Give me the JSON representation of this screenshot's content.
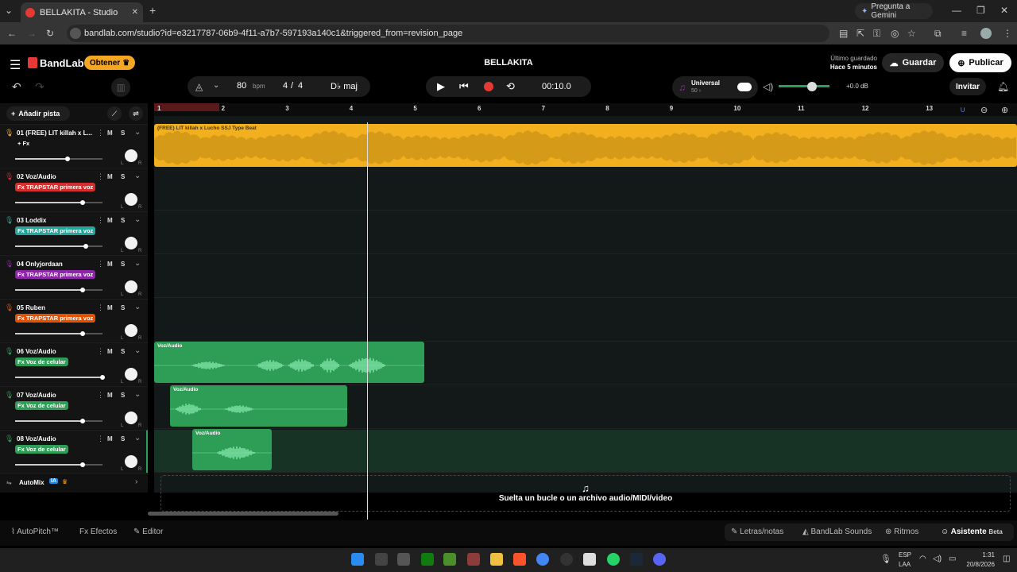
{
  "browser": {
    "tab_title": "BELLAKITA - Studio",
    "gemini": "Pregunta a Gemini",
    "url": "bandlab.com/studio?id=e3217787-06b9-4f11-a7b7-597193a140c1&triggered_from=revision_page"
  },
  "app": {
    "brand": "BandLab",
    "obtener": "Obtener",
    "project_title": "BELLAKITA",
    "saved_label": "Último guardado",
    "saved_time": "Hace 5 minutos",
    "save": "Guardar",
    "publish": "Publicar"
  },
  "toolbar": {
    "bpm": "80",
    "bpm_unit": "bpm",
    "sig_num": "4",
    "sig_sep": "/",
    "sig_den": "4",
    "key": "D♭ maj",
    "time": "00:10.0",
    "universal": "Universal",
    "universal_sub": "50 ›",
    "db": "+0.0 dB",
    "invite": "Invitar"
  },
  "left": {
    "add_track": "Añadir pista",
    "automix": "AutoMix",
    "ia": "IA"
  },
  "ruler": [
    "1",
    "2",
    "3",
    "4",
    "5",
    "6",
    "7",
    "8",
    "9",
    "10",
    "11",
    "12",
    "13"
  ],
  "tracks": [
    {
      "name": "01  (FREE) LIT killah x L...",
      "fx": "+ Fx",
      "fx_color": "#141414",
      "level": 0.6
    },
    {
      "name": "02  Voz/Audio",
      "fx": "Fx TRAPSTAR primera voz",
      "fx_color": "#d32f2f",
      "level": 0.77
    },
    {
      "name": "03  Loddix",
      "fx": "Fx TRAPSTAR primera voz",
      "fx_color": "#25a59b",
      "level": 0.81
    },
    {
      "name": "04  Onlyjordaan",
      "fx": "Fx TRAPSTAR primera voz",
      "fx_color": "#8e24aa",
      "level": 0.77
    },
    {
      "name": "05  Ruben",
      "fx": "Fx TRAPSTAR primera voz",
      "fx_color": "#e65100",
      "level": 0.77
    },
    {
      "name": "06  Voz/Audio",
      "fx": "Fx Voz de celular",
      "fx_color": "#2e9d55",
      "level": 1.0
    },
    {
      "name": "07  Voz/Audio",
      "fx": "Fx Voz de celular",
      "fx_color": "#2e9d55",
      "level": 0.77
    },
    {
      "name": "08  Voz/Audio",
      "fx": "Fx Voz de celular",
      "fx_color": "#2e9d55",
      "level": 0.77
    }
  ],
  "mute": "M",
  "solo": "S",
  "lr_l": "L",
  "lr_r": "R",
  "clips": {
    "beat": "(FREE) LIT killah x Lucho SSJ Type Beat",
    "c6": "Voz/Audio",
    "c7": "Voz/Audio",
    "c8": "Voz/Audio"
  },
  "drop": "Suelta un bucle o un archivo audio/MIDI/video",
  "bottom": {
    "autopitch": "AutoPitch™",
    "efectos": "Efectos",
    "editor": "Editor",
    "letras": "Letras/notas",
    "sounds": "BandLab Sounds",
    "ritmos": "Ritmos",
    "asistente": "Asistente",
    "beta": "Beta"
  },
  "taskbar": {
    "lang1": "ESP",
    "lang2": "LAA",
    "time": "1:31",
    "date": "20/8/2026"
  },
  "colors": {
    "accent": "#f5a623",
    "record": "#e53935",
    "green": "#2e9d55",
    "beat": "#f2b01e"
  }
}
